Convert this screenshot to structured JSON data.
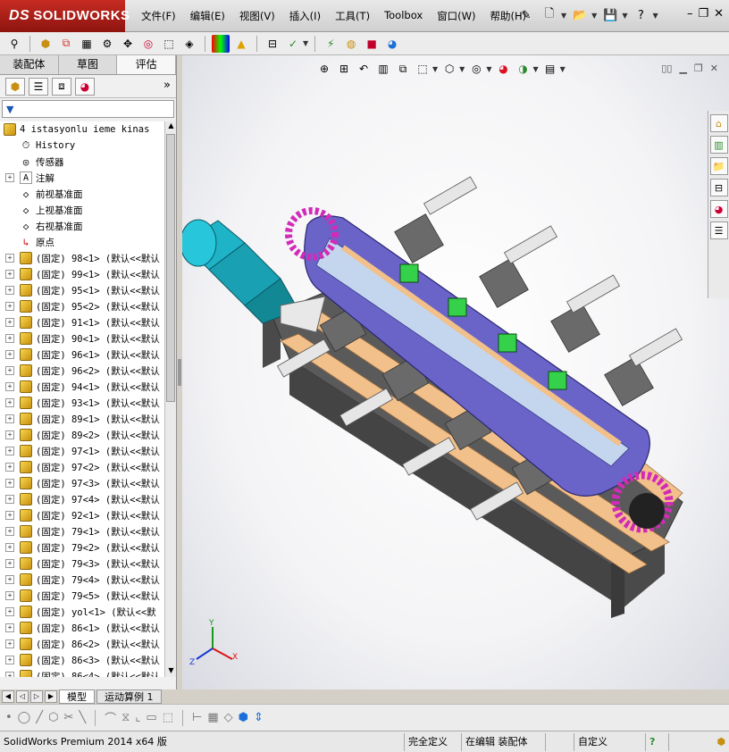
{
  "app": {
    "logo_prefix": "DS",
    "logo_text": "SOLIDWORKS"
  },
  "menu": [
    "文件(F)",
    "编辑(E)",
    "视图(V)",
    "插入(I)",
    "工具(T)",
    "Toolbox",
    "窗口(W)",
    "帮助(H)"
  ],
  "panel_tabs": [
    "装配体",
    "草图",
    "评估"
  ],
  "panel_active_tab": "评估",
  "tree": {
    "root": "4 istasyonlu ieme kinas",
    "items": [
      {
        "label": "History",
        "icon": "history-icon",
        "expandable": false
      },
      {
        "label": "传感器",
        "icon": "sensor-icon",
        "expandable": false
      },
      {
        "label": "注解",
        "icon": "annotation-icon",
        "expandable": true
      },
      {
        "label": "前视基准面",
        "icon": "plane-icon",
        "expandable": false
      },
      {
        "label": "上视基准面",
        "icon": "plane-icon",
        "expandable": false
      },
      {
        "label": "右视基准面",
        "icon": "plane-icon",
        "expandable": false
      },
      {
        "label": "原点",
        "icon": "origin-icon",
        "expandable": false
      },
      {
        "label": "(固定) 98<1> (默认<<默认",
        "icon": "part-icon",
        "expandable": true
      },
      {
        "label": "(固定) 99<1> (默认<<默认",
        "icon": "part-icon",
        "expandable": true
      },
      {
        "label": "(固定) 95<1> (默认<<默认",
        "icon": "part-icon",
        "expandable": true
      },
      {
        "label": "(固定) 95<2> (默认<<默认",
        "icon": "part-icon",
        "expandable": true
      },
      {
        "label": "(固定) 91<1> (默认<<默认",
        "icon": "part-icon",
        "expandable": true
      },
      {
        "label": "(固定) 90<1> (默认<<默认",
        "icon": "part-icon",
        "expandable": true
      },
      {
        "label": "(固定) 96<1> (默认<<默认",
        "icon": "part-icon",
        "expandable": true
      },
      {
        "label": "(固定) 96<2> (默认<<默认",
        "icon": "part-icon",
        "expandable": true
      },
      {
        "label": "(固定) 94<1> (默认<<默认",
        "icon": "part-icon",
        "expandable": true
      },
      {
        "label": "(固定) 93<1> (默认<<默认",
        "icon": "part-icon",
        "expandable": true
      },
      {
        "label": "(固定) 89<1> (默认<<默认",
        "icon": "part-icon",
        "expandable": true
      },
      {
        "label": "(固定) 89<2> (默认<<默认",
        "icon": "part-icon",
        "expandable": true
      },
      {
        "label": "(固定) 97<1> (默认<<默认",
        "icon": "part-icon",
        "expandable": true
      },
      {
        "label": "(固定) 97<2> (默认<<默认",
        "icon": "part-icon",
        "expandable": true
      },
      {
        "label": "(固定) 97<3> (默认<<默认",
        "icon": "part-icon",
        "expandable": true
      },
      {
        "label": "(固定) 97<4> (默认<<默认",
        "icon": "part-icon",
        "expandable": true
      },
      {
        "label": "(固定) 92<1> (默认<<默认",
        "icon": "part-icon",
        "expandable": true
      },
      {
        "label": "(固定) 79<1> (默认<<默认",
        "icon": "part-icon",
        "expandable": true
      },
      {
        "label": "(固定) 79<2> (默认<<默认",
        "icon": "part-icon",
        "expandable": true
      },
      {
        "label": "(固定) 79<3> (默认<<默认",
        "icon": "part-icon",
        "expandable": true
      },
      {
        "label": "(固定) 79<4> (默认<<默认",
        "icon": "part-icon",
        "expandable": true
      },
      {
        "label": "(固定) 79<5> (默认<<默认",
        "icon": "part-icon",
        "expandable": true
      },
      {
        "label": "(固定) yol<1> (默认<<默",
        "icon": "part-icon",
        "expandable": true
      },
      {
        "label": "(固定) 86<1> (默认<<默认",
        "icon": "part-icon",
        "expandable": true
      },
      {
        "label": "(固定) 86<2> (默认<<默认",
        "icon": "part-icon",
        "expandable": true
      },
      {
        "label": "(固定) 86<3> (默认<<默认",
        "icon": "part-icon",
        "expandable": true
      },
      {
        "label": "(固定) 86<4> (默认<<默认",
        "icon": "part-icon",
        "expandable": true
      }
    ]
  },
  "bottom_tabs": [
    "模型",
    "运动算例 1"
  ],
  "status": {
    "product": "SolidWorks Premium 2014 x64 版",
    "constraint": "完全定义",
    "editing": "在编辑 装配体",
    "units": "自定义"
  },
  "colors": {
    "logo_red": "#b3201a",
    "motor_cyan": "#1fb3c8",
    "gear_magenta": "#d12bb8",
    "plate_violet": "#6a64c8",
    "wood_orange": "#f2c08a",
    "frame_dark": "#555555",
    "sensor_green": "#35d14a"
  }
}
